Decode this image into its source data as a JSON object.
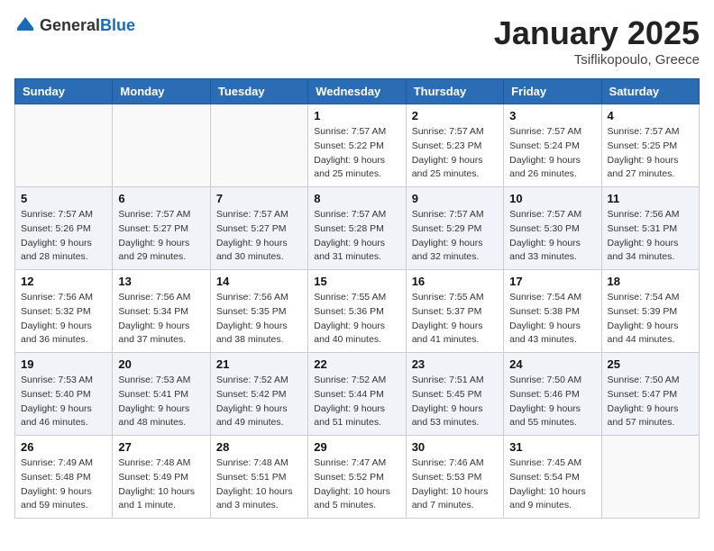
{
  "header": {
    "logo_general": "General",
    "logo_blue": "Blue",
    "month": "January 2025",
    "location": "Tsiflikopoulo, Greece"
  },
  "days_of_week": [
    "Sunday",
    "Monday",
    "Tuesday",
    "Wednesday",
    "Thursday",
    "Friday",
    "Saturday"
  ],
  "weeks": [
    [
      {
        "day": "",
        "info": ""
      },
      {
        "day": "",
        "info": ""
      },
      {
        "day": "",
        "info": ""
      },
      {
        "day": "1",
        "info": "Sunrise: 7:57 AM\nSunset: 5:22 PM\nDaylight: 9 hours\nand 25 minutes."
      },
      {
        "day": "2",
        "info": "Sunrise: 7:57 AM\nSunset: 5:23 PM\nDaylight: 9 hours\nand 25 minutes."
      },
      {
        "day": "3",
        "info": "Sunrise: 7:57 AM\nSunset: 5:24 PM\nDaylight: 9 hours\nand 26 minutes."
      },
      {
        "day": "4",
        "info": "Sunrise: 7:57 AM\nSunset: 5:25 PM\nDaylight: 9 hours\nand 27 minutes."
      }
    ],
    [
      {
        "day": "5",
        "info": "Sunrise: 7:57 AM\nSunset: 5:26 PM\nDaylight: 9 hours\nand 28 minutes."
      },
      {
        "day": "6",
        "info": "Sunrise: 7:57 AM\nSunset: 5:27 PM\nDaylight: 9 hours\nand 29 minutes."
      },
      {
        "day": "7",
        "info": "Sunrise: 7:57 AM\nSunset: 5:27 PM\nDaylight: 9 hours\nand 30 minutes."
      },
      {
        "day": "8",
        "info": "Sunrise: 7:57 AM\nSunset: 5:28 PM\nDaylight: 9 hours\nand 31 minutes."
      },
      {
        "day": "9",
        "info": "Sunrise: 7:57 AM\nSunset: 5:29 PM\nDaylight: 9 hours\nand 32 minutes."
      },
      {
        "day": "10",
        "info": "Sunrise: 7:57 AM\nSunset: 5:30 PM\nDaylight: 9 hours\nand 33 minutes."
      },
      {
        "day": "11",
        "info": "Sunrise: 7:56 AM\nSunset: 5:31 PM\nDaylight: 9 hours\nand 34 minutes."
      }
    ],
    [
      {
        "day": "12",
        "info": "Sunrise: 7:56 AM\nSunset: 5:32 PM\nDaylight: 9 hours\nand 36 minutes."
      },
      {
        "day": "13",
        "info": "Sunrise: 7:56 AM\nSunset: 5:34 PM\nDaylight: 9 hours\nand 37 minutes."
      },
      {
        "day": "14",
        "info": "Sunrise: 7:56 AM\nSunset: 5:35 PM\nDaylight: 9 hours\nand 38 minutes."
      },
      {
        "day": "15",
        "info": "Sunrise: 7:55 AM\nSunset: 5:36 PM\nDaylight: 9 hours\nand 40 minutes."
      },
      {
        "day": "16",
        "info": "Sunrise: 7:55 AM\nSunset: 5:37 PM\nDaylight: 9 hours\nand 41 minutes."
      },
      {
        "day": "17",
        "info": "Sunrise: 7:54 AM\nSunset: 5:38 PM\nDaylight: 9 hours\nand 43 minutes."
      },
      {
        "day": "18",
        "info": "Sunrise: 7:54 AM\nSunset: 5:39 PM\nDaylight: 9 hours\nand 44 minutes."
      }
    ],
    [
      {
        "day": "19",
        "info": "Sunrise: 7:53 AM\nSunset: 5:40 PM\nDaylight: 9 hours\nand 46 minutes."
      },
      {
        "day": "20",
        "info": "Sunrise: 7:53 AM\nSunset: 5:41 PM\nDaylight: 9 hours\nand 48 minutes."
      },
      {
        "day": "21",
        "info": "Sunrise: 7:52 AM\nSunset: 5:42 PM\nDaylight: 9 hours\nand 49 minutes."
      },
      {
        "day": "22",
        "info": "Sunrise: 7:52 AM\nSunset: 5:44 PM\nDaylight: 9 hours\nand 51 minutes."
      },
      {
        "day": "23",
        "info": "Sunrise: 7:51 AM\nSunset: 5:45 PM\nDaylight: 9 hours\nand 53 minutes."
      },
      {
        "day": "24",
        "info": "Sunrise: 7:50 AM\nSunset: 5:46 PM\nDaylight: 9 hours\nand 55 minutes."
      },
      {
        "day": "25",
        "info": "Sunrise: 7:50 AM\nSunset: 5:47 PM\nDaylight: 9 hours\nand 57 minutes."
      }
    ],
    [
      {
        "day": "26",
        "info": "Sunrise: 7:49 AM\nSunset: 5:48 PM\nDaylight: 9 hours\nand 59 minutes."
      },
      {
        "day": "27",
        "info": "Sunrise: 7:48 AM\nSunset: 5:49 PM\nDaylight: 10 hours\nand 1 minute."
      },
      {
        "day": "28",
        "info": "Sunrise: 7:48 AM\nSunset: 5:51 PM\nDaylight: 10 hours\nand 3 minutes."
      },
      {
        "day": "29",
        "info": "Sunrise: 7:47 AM\nSunset: 5:52 PM\nDaylight: 10 hours\nand 5 minutes."
      },
      {
        "day": "30",
        "info": "Sunrise: 7:46 AM\nSunset: 5:53 PM\nDaylight: 10 hours\nand 7 minutes."
      },
      {
        "day": "31",
        "info": "Sunrise: 7:45 AM\nSunset: 5:54 PM\nDaylight: 10 hours\nand 9 minutes."
      },
      {
        "day": "",
        "info": ""
      }
    ]
  ]
}
